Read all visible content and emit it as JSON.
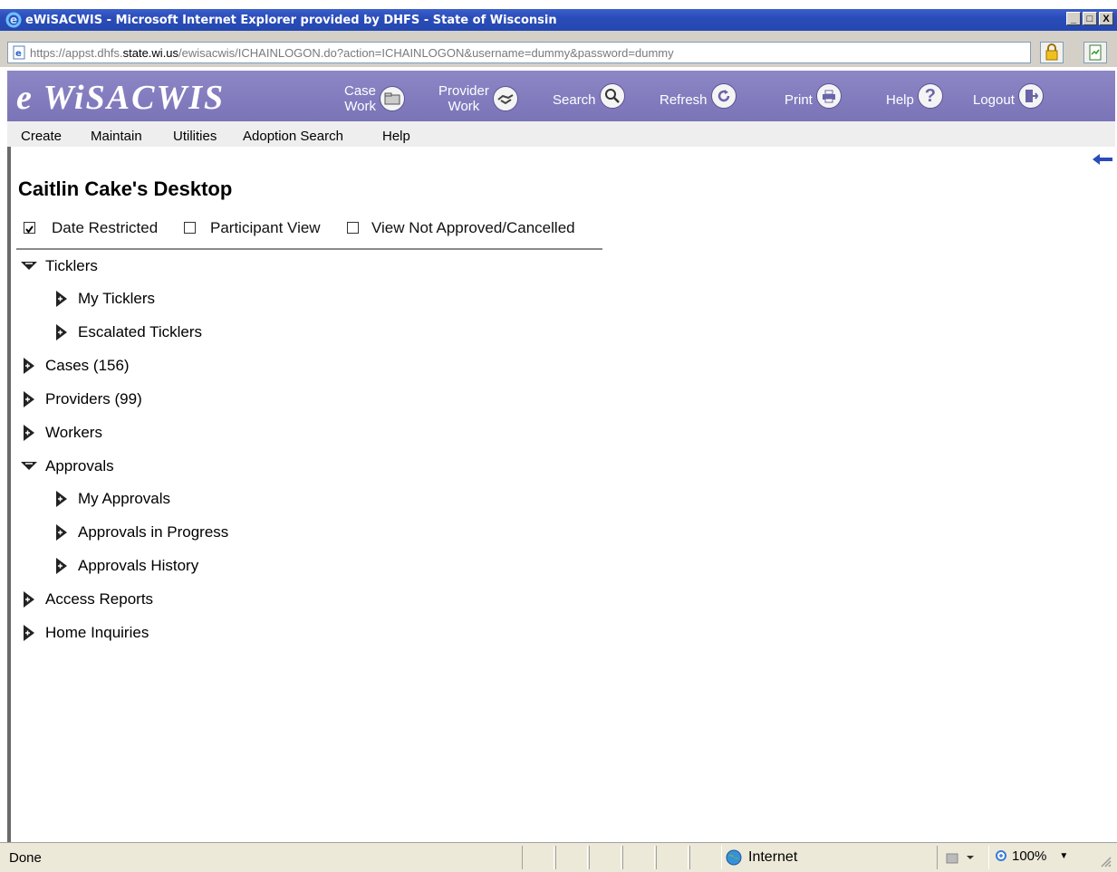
{
  "window": {
    "title": "eWiSACWIS - Microsoft Internet Explorer provided by DHFS - State of Wisconsin",
    "minimize": "_",
    "maximize": "□",
    "close": "X"
  },
  "address": {
    "url_prefix": "https://appst.dhfs.",
    "url_domain": "state.wi.us",
    "url_rest": "/ewisacwis/ICHAINLOGON.do?action=ICHAINLOGON&username=dummy&password=dummy"
  },
  "banner": {
    "logo": "e WiSACWIS",
    "nav": [
      {
        "l1": "Case",
        "l2": "Work",
        "icon": "folder-icon"
      },
      {
        "l1": "Provider",
        "l2": "Work",
        "icon": "handshake-icon"
      },
      {
        "l1": "Search",
        "l2": "",
        "icon": "magnifier-icon"
      },
      {
        "l1": "Refresh",
        "l2": "",
        "icon": "refresh-icon"
      },
      {
        "l1": "Print",
        "l2": "",
        "icon": "printer-icon"
      },
      {
        "l1": "Help",
        "l2": "",
        "icon": "question-icon"
      },
      {
        "l1": "Logout",
        "l2": "",
        "icon": "door-exit-icon"
      }
    ]
  },
  "menu": {
    "items": [
      "Create",
      "Maintain",
      "Utilities",
      "Adoption Search",
      "Help"
    ]
  },
  "desktop": {
    "title": "Caitlin Cake's Desktop",
    "filters": [
      {
        "label": "Date Restricted",
        "checked": true
      },
      {
        "label": "Participant View",
        "checked": false
      },
      {
        "label": "View Not Approved/Cancelled",
        "checked": false
      }
    ],
    "tree": [
      {
        "label": "Ticklers",
        "expanded": true,
        "level": 0
      },
      {
        "label": "My Ticklers",
        "expanded": false,
        "level": 1
      },
      {
        "label": "Escalated Ticklers",
        "expanded": false,
        "level": 1
      },
      {
        "label": "Cases (156)",
        "expanded": false,
        "level": 0
      },
      {
        "label": "Providers (99)",
        "expanded": false,
        "level": 0
      },
      {
        "label": "Workers",
        "expanded": false,
        "level": 0
      },
      {
        "label": "Approvals",
        "expanded": true,
        "level": 0
      },
      {
        "label": "My Approvals",
        "expanded": false,
        "level": 1
      },
      {
        "label": "Approvals in Progress",
        "expanded": false,
        "level": 1
      },
      {
        "label": "Approvals History",
        "expanded": false,
        "level": 1
      },
      {
        "label": "Access Reports",
        "expanded": false,
        "level": 0
      },
      {
        "label": "Home Inquiries",
        "expanded": false,
        "level": 0
      }
    ]
  },
  "status": {
    "text": "Done",
    "zone": "Internet",
    "zoom": "100%"
  },
  "colors": {
    "banner": "#7a74b8",
    "titlebar": "#2a4cb8",
    "menubar": "#eeeeee"
  }
}
